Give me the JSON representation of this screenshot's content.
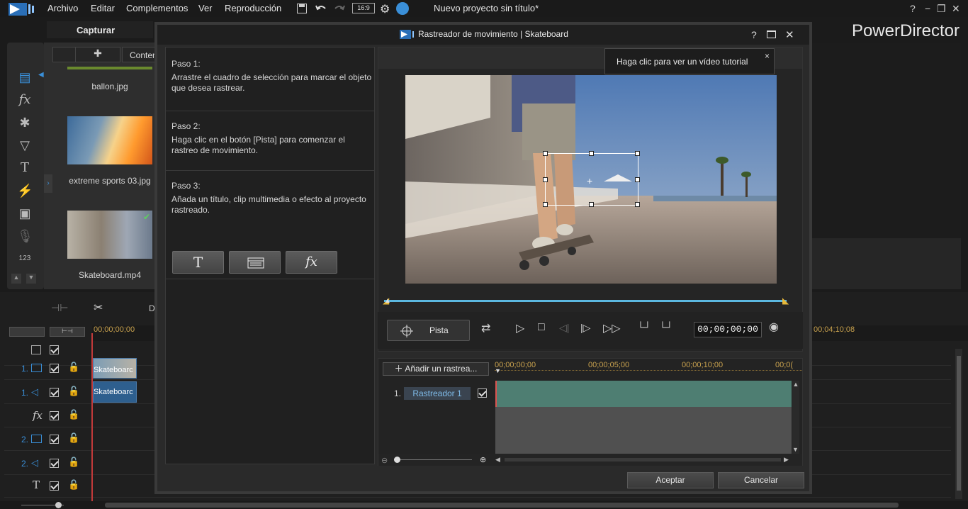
{
  "menubar": {
    "items": [
      "Archivo",
      "Editar",
      "Complementos",
      "Ver",
      "Reproducción"
    ],
    "aspect_ratio": "16:9",
    "project_title": "Nuevo proyecto sin título*",
    "help": "?"
  },
  "app": {
    "capture_tab": "Capturar",
    "brand": "PowerDirector",
    "library_tab_content": "Conten",
    "library_items": [
      "ballon.jpg",
      "extreme sports 03.jpg",
      "Skateboard.mp4"
    ],
    "toolbar_partial": "Di",
    "timeline_start": "00;00;00;00",
    "timeline_far": "00;04;10;08",
    "timeline_clips": [
      "Skateboarc",
      "Skateboarc"
    ],
    "track_labels": [
      "1.",
      "1.",
      "2.",
      "2."
    ],
    "colors": {
      "accent": "#3a8fd8",
      "tracker_clip": "#4e7e72",
      "ruler_text": "#c9a24e",
      "scrub": "#5bb7e0"
    }
  },
  "dialog": {
    "title": "Rastreador de movimiento  |  Skateboard",
    "help": "?",
    "steps": [
      {
        "heading": "Paso 1:",
        "text": "Arrastre el cuadro de selección para marcar el objeto que desea rastrear."
      },
      {
        "heading": "Paso 2:",
        "text": "Haga clic en el botón [Pista] para comenzar el rastreo de movimiento."
      },
      {
        "heading": "Paso 3:",
        "text": "Añada un título, clip multimedia o efecto al proyecto rastreado."
      }
    ],
    "tooltip": "Haga clic para ver un vídeo tutorial",
    "tooltip_close": "×",
    "pista_label": "Pista",
    "timecode": "00;00;00;00",
    "add_tracker": "Añadir un rastrea...",
    "ruler": [
      "00;00;00;00",
      "00;00;05;00",
      "00;00;10;00",
      "00;0("
    ],
    "tracker_number": "1.",
    "tracker_name": "Rastreador 1",
    "accept": "Aceptar",
    "cancel": "Cancelar"
  }
}
